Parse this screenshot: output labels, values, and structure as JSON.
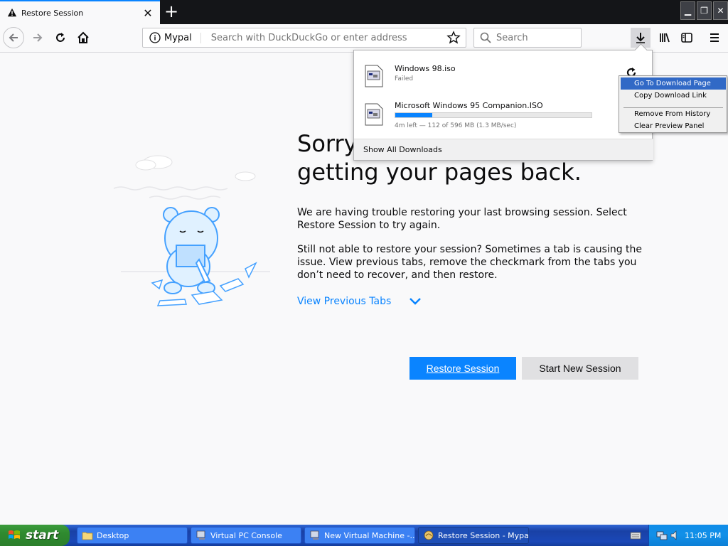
{
  "tab": {
    "title": "Restore Session",
    "close_glyph": "✕",
    "warning_icon": "warning-icon"
  },
  "newtab_glyph": "+",
  "window_controls": {
    "minimize": "▁",
    "restore": "❐",
    "close": "✕"
  },
  "navbar": {
    "identity_label": "Mypal",
    "address_placeholder": "Search with DuckDuckGo or enter address",
    "search_placeholder": "Search"
  },
  "page": {
    "heading": "Sorry. We’re having trouble getting your pages back.",
    "para1": "We are having trouble restoring your last browsing session. Select Restore Session to try again.",
    "para2": "Still not able to restore your session? Sometimes a tab is causing the issue. View previous tabs, remove the checkmark from the tabs you don’t need to recover, and then restore.",
    "view_previous_tabs": "View Previous Tabs",
    "restore_button": "Restore Session",
    "new_session_button": "Start New Session"
  },
  "downloads": {
    "items": [
      {
        "name": "Windows 98.iso",
        "status": "Failed"
      },
      {
        "name": "Microsoft Windows 95 Companion.ISO",
        "status": "4m left — 112 of 596 MB (1.3 MB/sec)",
        "progress": 0.188
      }
    ],
    "show_all": "Show All Downloads"
  },
  "context_menu": {
    "items": [
      "Go To Download Page",
      "Copy Download Link",
      "Remove From History",
      "Clear Preview Panel"
    ],
    "highlighted_index": 0
  },
  "taskbar": {
    "start_label": "start",
    "items": [
      {
        "label": "Desktop"
      },
      {
        "label": "Virtual PC Console"
      },
      {
        "label": "New Virtual Machine -..."
      },
      {
        "label": "Restore Session - Mypal"
      }
    ],
    "active_index": 3,
    "clock": "11:05 PM"
  },
  "colors": {
    "accent": "#0a84ff",
    "tabstrip": "#141518",
    "taskbar": "#1941a5",
    "start_green": "#2f8a2f"
  }
}
